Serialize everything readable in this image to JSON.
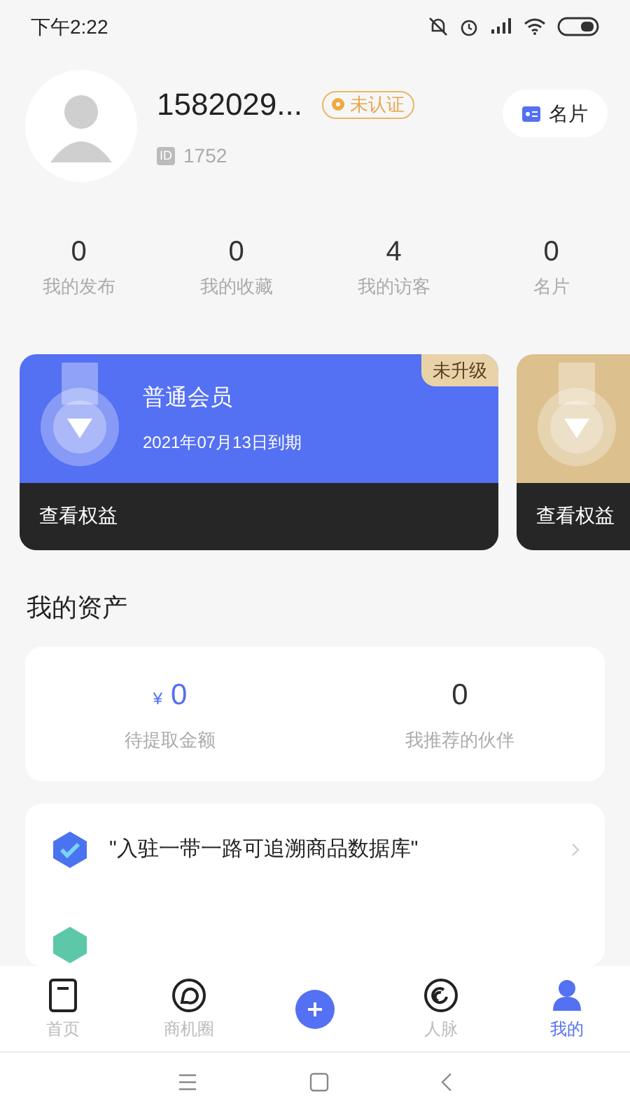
{
  "status_bar": {
    "time": "下午2:22"
  },
  "profile": {
    "name": "1582029...",
    "badge": "未认证",
    "id_label": "ID",
    "id": "1752",
    "card_button": "名片"
  },
  "stats": [
    {
      "value": "0",
      "label": "我的发布"
    },
    {
      "value": "0",
      "label": "我的收藏"
    },
    {
      "value": "4",
      "label": "我的访客"
    },
    {
      "value": "0",
      "label": "名片"
    }
  ],
  "memberships": [
    {
      "color": "#5470f3",
      "tag": "未升级",
      "title": "普通会员",
      "expiry": "2021年07月13日到期",
      "action": "查看权益"
    },
    {
      "color": "#dcc08e",
      "action": "查看权益"
    }
  ],
  "assets": {
    "title": "我的资产",
    "items": [
      {
        "value": "0",
        "currency": "¥",
        "label": "待提取金额"
      },
      {
        "value": "0",
        "label": "我推荐的伙伴"
      }
    ]
  },
  "menu": [
    {
      "kind": "verified",
      "label": "\"入驻一带一路可追溯商品数据库\""
    },
    {
      "kind": "invite"
    }
  ],
  "tabs": [
    {
      "kind": "home",
      "label": "首页",
      "selected": false
    },
    {
      "kind": "circle",
      "label": "商机圈",
      "selected": false
    },
    {
      "kind": "add",
      "selected": false
    },
    {
      "kind": "contacts",
      "label": "人脉",
      "selected": false
    },
    {
      "kind": "me",
      "label": "我的",
      "selected": true
    }
  ]
}
